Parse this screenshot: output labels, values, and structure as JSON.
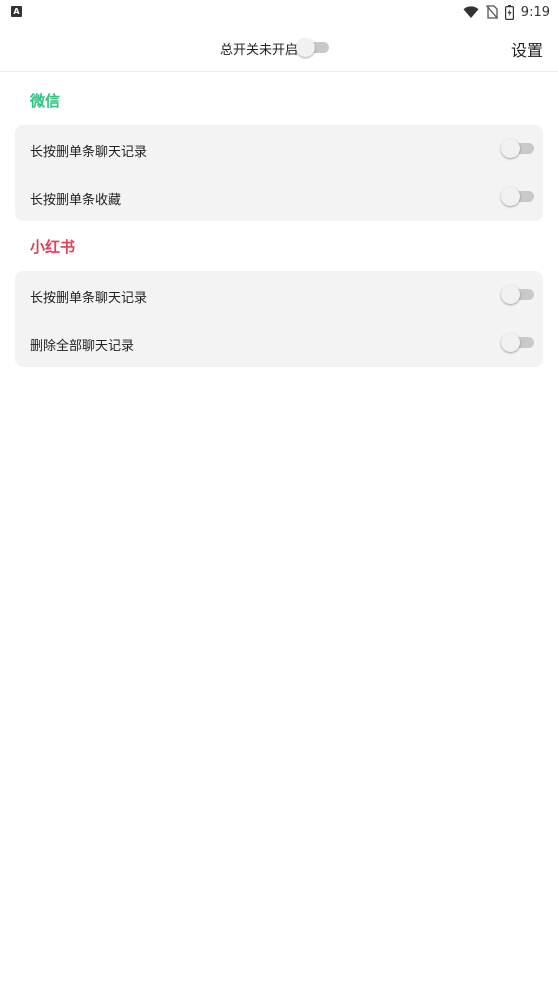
{
  "status_bar": {
    "left_icon": "A",
    "time": "9:19",
    "icons": [
      "wifi-icon",
      "no-sim-icon",
      "battery-icon"
    ]
  },
  "header": {
    "master_switch_label": "总开关未开启",
    "master_switch_on": false,
    "settings_label": "设置"
  },
  "sections": [
    {
      "title": "微信",
      "title_color": "#2ec27e",
      "items": [
        {
          "label": "长按删单条聊天记录",
          "on": false
        },
        {
          "label": "长按删单条收藏",
          "on": false
        }
      ]
    },
    {
      "title": "小红书",
      "title_color": "#e0405a",
      "items": [
        {
          "label": "长按删单条聊天记录",
          "on": false
        },
        {
          "label": "删除全部聊天记录",
          "on": false
        }
      ]
    }
  ]
}
